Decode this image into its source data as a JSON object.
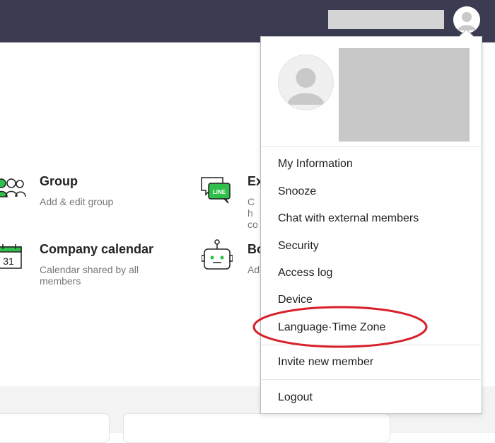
{
  "cards": [
    {
      "title": "Group",
      "desc": "Add & edit group",
      "icon": "people-group-icon"
    },
    {
      "title": "Ex",
      "desc": "Ch co",
      "icon": "line-chat-icon"
    },
    {
      "title": "Company calendar",
      "desc": "Calendar shared by all members",
      "icon": "calendar-icon",
      "icon_text": "31"
    },
    {
      "title": "Bo",
      "desc": "Ad",
      "icon": "bot-icon"
    }
  ],
  "line_badge_text": "LINE",
  "menu": {
    "items": [
      "My Information",
      "Snooze",
      "Chat with external members",
      "Security",
      "Access log",
      "Device",
      "Language·Time Zone",
      "Invite new member",
      "Logout"
    ]
  },
  "colors": {
    "topbar": "#3b3b52",
    "green_accent": "#2fbf4a",
    "highlight_circle": "#d8202a"
  }
}
